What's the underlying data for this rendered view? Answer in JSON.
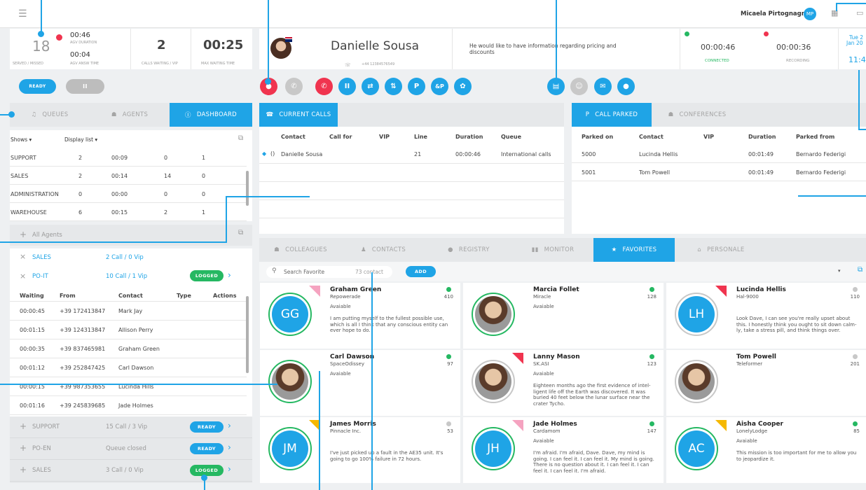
{
  "topbar": {
    "user_name": "Micaela Pirtognagni",
    "user_initials": "MP"
  },
  "stats": {
    "served": "18",
    "avg_duration": "00:46",
    "avg_duration_label": "AGV DURATION",
    "avg_answ": "00:04",
    "avg_answ_label": "AGV ANSW TIME",
    "served_label": "SERVED / MISSED",
    "calls_waiting": "2",
    "calls_waiting_label": "CALLS WAITING / VIP",
    "max_wait": "00:25",
    "max_wait_label": "MAX WAITING TIME"
  },
  "controls": {
    "ready_label": "READY",
    "pause_label": "II"
  },
  "caller": {
    "name": "Danielle Sousa",
    "phone": "+44 12384576549",
    "note": "He would like to have information regarding pricing and discounts",
    "connected_time": "00:00:46",
    "connected_label": "CONNECTED",
    "recording_time": "00:00:36",
    "recording_label": "RECORDING",
    "date_line1": "Tue 2",
    "date_line2": "Jan 20",
    "clock": "11:4"
  },
  "left_tabs": {
    "queues": "QUEUES",
    "agents": "AGENTS",
    "dashboard": "DASHBOARD"
  },
  "filters": {
    "shows": "Shows ▾",
    "display": "Display list ▾"
  },
  "queues": [
    {
      "name": "SUPPORT",
      "a": "2",
      "b": "00:09",
      "c": "0",
      "d": "1"
    },
    {
      "name": "SALES",
      "a": "2",
      "b": "00:14",
      "c": "14",
      "d": "0"
    },
    {
      "name": "ADMINISTRATION",
      "a": "0",
      "b": "00:00",
      "c": "0",
      "d": "0"
    },
    {
      "name": "WAREHOUSE",
      "a": "6",
      "b": "00:15",
      "c": "2",
      "d": "1"
    }
  ],
  "all_agents": "All Agents",
  "groups_top": [
    {
      "name": "SALES",
      "info": "2 Call / 0 Vip"
    },
    {
      "name": "PO-IT",
      "info": "10 Call / 1 Vip",
      "badge": "LOGGED"
    }
  ],
  "waiting_headers": {
    "waiting": "Waiting",
    "from": "From",
    "contact": "Contact",
    "type": "Type",
    "actions": "Actions"
  },
  "waiting": [
    {
      "time": "00:00:45",
      "from": "+39 172413847",
      "contact": "Mark Jay"
    },
    {
      "time": "00:01:15",
      "from": "+39 124313847",
      "contact": "Allison Perry"
    },
    {
      "time": "00:00:35",
      "from": "+39 837465981",
      "contact": "Graham Green"
    },
    {
      "time": "00:01:12",
      "from": "+39 252847425",
      "contact": "Carl Dawson"
    },
    {
      "time": "00:00:15",
      "from": "+39 987353655",
      "contact": "Lucinda Hills"
    },
    {
      "time": "00:01:16",
      "from": "+39 245839685",
      "contact": "Jade Holmes"
    }
  ],
  "groups_bottom": [
    {
      "name": "SUPPORT",
      "info": "15 Call / 3 Vip",
      "badge": "READY"
    },
    {
      "name": "PO-EN",
      "info": "Queue closed",
      "badge": "READY"
    },
    {
      "name": "SALES",
      "info": "3 Call / 0 Vip",
      "badge": "LOGGED"
    }
  ],
  "current_calls": {
    "tab": "CURRENT CALLS",
    "headers": {
      "contact": "Contact",
      "call_for": "Call for",
      "vip": "VIP",
      "line": "Line",
      "duration": "Duration",
      "queue": "Queue"
    },
    "rows": [
      {
        "contact": "Danielle Sousa",
        "line": "21",
        "duration": "00:00:46",
        "queue": "International calls"
      }
    ]
  },
  "parked": {
    "tab": "CALL PARKED",
    "tab2": "CONFERENCES",
    "headers": {
      "parked_on": "Parked on",
      "contact": "Contact",
      "vip": "VIP",
      "duration": "Duration",
      "from": "Parked from"
    },
    "rows": [
      {
        "on": "5000",
        "contact": "Lucinda Hellis",
        "duration": "00:01:49",
        "from": "Bernardo Federigi"
      },
      {
        "on": "5001",
        "contact": "Tom Powell",
        "duration": "00:01:49",
        "from": "Bernardo Federigi"
      }
    ]
  },
  "bottom_tabs": {
    "colleagues": "COLLEAGUES",
    "contacts": "CONTACTS",
    "registry": "REGISTRY",
    "monitor": "MONITOR",
    "favorites": "FAVORITES",
    "personale": "PERSONALE"
  },
  "search": {
    "placeholder": "Search Favorite",
    "count": "73 contact",
    "add": "ADD"
  },
  "cards": [
    {
      "name": "Graham Green",
      "company": "Repowerade",
      "num": "410",
      "status": "Avaiable",
      "note": "I am putting myself to the fullest possible use, which is all I think that any conscious entity can ever hope to do.",
      "initials": "GG"
    },
    {
      "name": "Marcia Follet",
      "company": "Miracle",
      "num": "128",
      "status": "Avaiable",
      "note": ""
    },
    {
      "name": "Lucinda Hellis",
      "company": "Hal-9000",
      "num": "110",
      "status": "",
      "note": "Look Dave, I can see you're really upset about this. I honestly think you ought to sit down calm-ly, take a stress pill, and think things over.",
      "initials": "LH"
    },
    {
      "name": "Carl Dawson",
      "company": "SpaceOdissey",
      "num": "97",
      "status": "Avaiable",
      "note": ""
    },
    {
      "name": "Lanny Mason",
      "company": "SK.ASI",
      "num": "123",
      "status": "Avaiable",
      "note": "Eighteen months ago the first evidence of intel-ligent life off the Earth was discovered. It was buried 40 feet below the lunar surface near the crater Tycho."
    },
    {
      "name": "Tom Powell",
      "company": "Teleformer",
      "num": "201",
      "status": "",
      "note": ""
    },
    {
      "name": "James Morris",
      "company": "Pinnacle Inc.",
      "num": "53",
      "status": "",
      "note": "I've just picked up a fault in the AE35 unit. It's going to go 100% failure in 72 hours.",
      "initials": "JM"
    },
    {
      "name": "Jade Holmes",
      "company": "Cardamom",
      "num": "147",
      "status": "Avaiable",
      "note": "I'm afraid. I'm afraid, Dave. Dave, my mind is going. I can feel it. I can feel it. My mind is going. There is no question about it. I can feel it. I can feel it. I can feel it. I'm afraid.",
      "initials": "JH"
    },
    {
      "name": "Aisha Cooper",
      "company": "LonelyLodge",
      "num": "85",
      "status": "Avaiable",
      "note": "This mission is too important for me to allow you to jeopardize it.",
      "initials": "AC"
    }
  ],
  "colors": {
    "accent": "#1fa4e6",
    "green": "#25b862",
    "red": "#f0344f"
  }
}
